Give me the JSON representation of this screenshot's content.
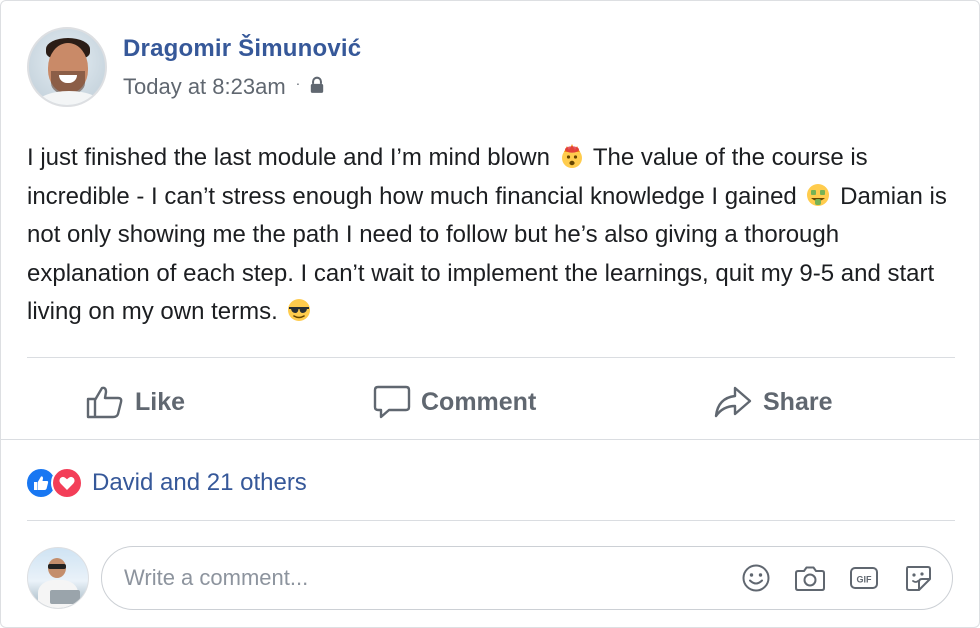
{
  "post": {
    "author": "Dragomir Šimunović",
    "timestamp": "Today at 8:23am",
    "separator": "·",
    "privacy_icon": "lock-icon",
    "text_parts": [
      "I just finished the last module and I’m mind blown",
      "The value of the course is incredible - I can’t stress enough how much financial knowledge I gained",
      "Damian is not only showing me the path I need to follow but he’s also giving a thorough explanation of each step. I can’t wait to implement the learnings, quit my 9-5 and start living on my own terms."
    ],
    "emojis": [
      "exploding-head-emoji",
      "money-mouth-face-emoji",
      "sunglasses-face-emoji"
    ]
  },
  "actions": {
    "like_label": "Like",
    "comment_label": "Comment",
    "share_label": "Share"
  },
  "reactions": {
    "icons": [
      "like-reaction-icon",
      "love-reaction-icon"
    ],
    "summary": "David and 21 others"
  },
  "comment": {
    "placeholder": "Write a comment...",
    "value": "",
    "tools": [
      "emoji-icon",
      "camera-icon",
      "gif-icon",
      "sticker-icon"
    ]
  },
  "colors": {
    "name_blue": "#365899",
    "meta_gray": "#606770",
    "like_blue": "#1877f2",
    "love_red": "#f33e58",
    "divider": "#dadde1"
  }
}
